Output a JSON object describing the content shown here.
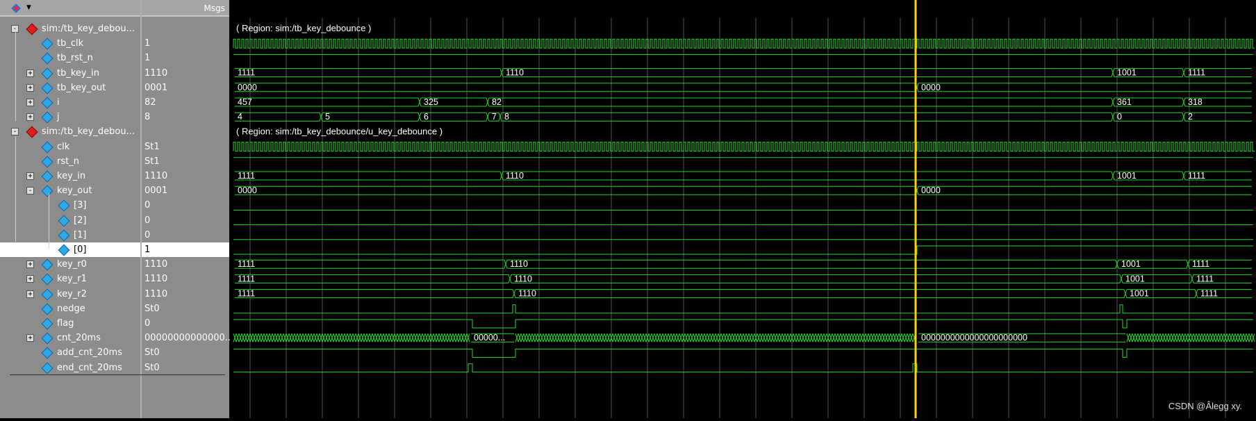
{
  "header": {
    "msgs_label": "Msgs"
  },
  "rows": [
    {
      "name": "sim:/tb_key_debou...",
      "value": "",
      "region": "( Region: sim:/tb_key_debounce )"
    },
    {
      "name": "tb_clk",
      "value": "1"
    },
    {
      "name": "tb_rst_n",
      "value": "1"
    },
    {
      "name": "tb_key_in",
      "value": "1110"
    },
    {
      "name": "tb_key_out",
      "value": "0001"
    },
    {
      "name": "i",
      "value": "82"
    },
    {
      "name": "j",
      "value": "8"
    },
    {
      "name": "sim:/tb_key_debou...",
      "value": "",
      "region": "( Region: sim:/tb_key_debounce/u_key_debounce )"
    },
    {
      "name": "clk",
      "value": "St1"
    },
    {
      "name": "rst_n",
      "value": "St1"
    },
    {
      "name": "key_in",
      "value": "1110"
    },
    {
      "name": "key_out",
      "value": "0001"
    },
    {
      "name": "[3]",
      "value": "0"
    },
    {
      "name": "[2]",
      "value": "0"
    },
    {
      "name": "[1]",
      "value": "0"
    },
    {
      "name": "[0]",
      "value": "1"
    },
    {
      "name": "key_r0",
      "value": "1110"
    },
    {
      "name": "key_r1",
      "value": "1110"
    },
    {
      "name": "key_r2",
      "value": "1110"
    },
    {
      "name": "nedge",
      "value": "St0"
    },
    {
      "name": "flag",
      "value": "0"
    },
    {
      "name": "cnt_20ms",
      "value": "00000000000000..."
    },
    {
      "name": "add_cnt_20ms",
      "value": "St0"
    },
    {
      "name": "end_cnt_20ms",
      "value": "St0"
    }
  ],
  "bus_labels": {
    "tb_key_in": [
      "1111",
      "1110",
      "1001",
      "1111"
    ],
    "tb_key_out": [
      "0000",
      "0000"
    ],
    "i": [
      "457",
      "325",
      "82",
      "361",
      "318"
    ],
    "j": [
      "4",
      "5",
      "6",
      "7",
      "8",
      "0",
      "2"
    ],
    "key_in": [
      "1111",
      "1110",
      "1001",
      "1111"
    ],
    "key_out": [
      "0000",
      "0000"
    ],
    "key_r0": [
      "1111",
      "1110",
      "1001",
      "1111"
    ],
    "key_r1": [
      "1111",
      "1110",
      "1001",
      "1111"
    ],
    "key_r2": [
      "1111",
      "1110",
      "1001",
      "1111"
    ],
    "cnt_20ms": [
      "00000...",
      "0000000000000000000000"
    ]
  },
  "watermark": "CSDN @Âlegg xy.",
  "colors": {
    "wave": "#22dd22",
    "cursor": "#ffd200",
    "grid": "#555555",
    "panel": "#8c8c8c"
  }
}
